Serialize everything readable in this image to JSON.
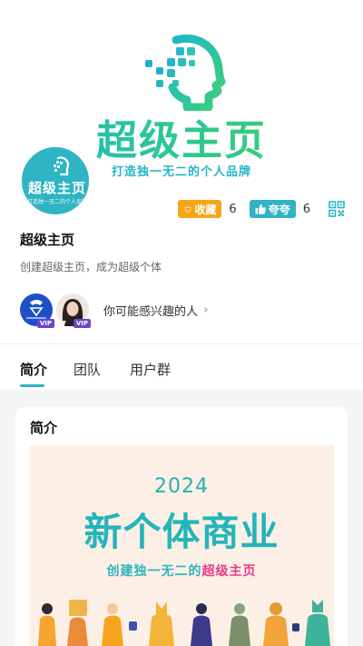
{
  "hero": {
    "title": "超级主页",
    "slogan": "打造独一无二的个人品牌",
    "logo_icon": "ai-head-icon"
  },
  "profile": {
    "avatar_brand": "超级主页",
    "avatar_sub": "打造独一无二的个人品牌",
    "name": "超级主页",
    "description": "创建超级主页，成为超级个体"
  },
  "stats": {
    "favorite_label": "收藏",
    "favorite_count": "6",
    "like_label": "夸夸",
    "like_count": "6",
    "qr_icon": "qr-code-icon"
  },
  "suggest": {
    "avatar1_badge": "VIP",
    "avatar2_badge": "VIP",
    "text": "你可能感兴趣的人",
    "chevron": "›"
  },
  "tabs": [
    {
      "label": "简介",
      "active": true
    },
    {
      "label": "团队",
      "active": false
    },
    {
      "label": "用户群",
      "active": false
    }
  ],
  "content": {
    "card_title": "简介",
    "banner_year": "2024",
    "banner_headline": "新个体商业",
    "banner_sub_prefix": "创建独一无二的",
    "banner_sub_highlight": "超级主页"
  },
  "colors": {
    "accent": "#2fb4c4",
    "favorite": "#f5a518",
    "highlight": "#e8398b",
    "banner_bg": "#fcf0e6"
  }
}
